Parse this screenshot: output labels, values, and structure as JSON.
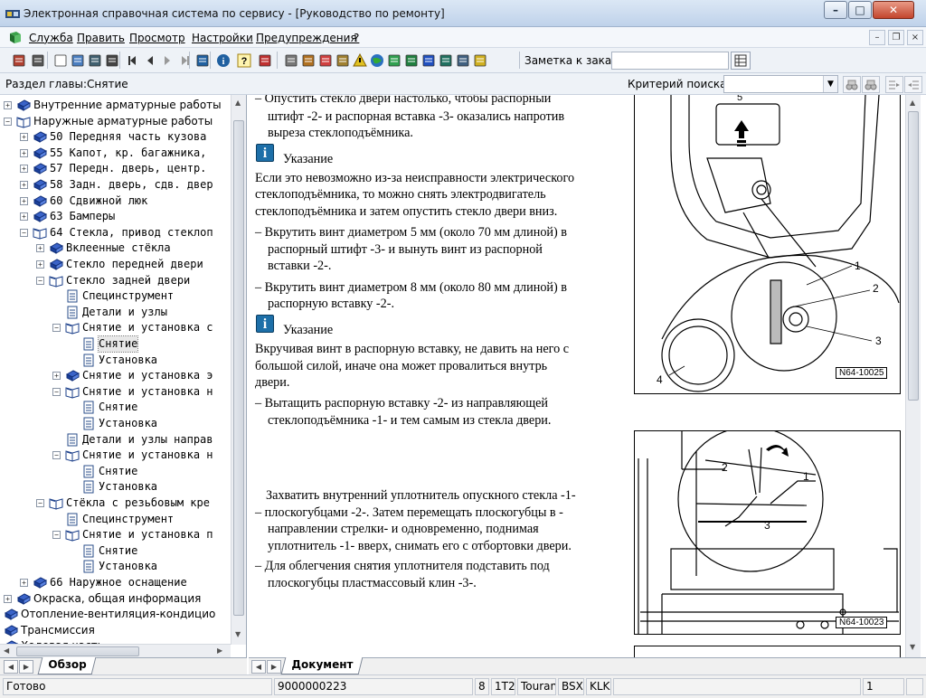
{
  "window": {
    "title": "Электронная справочная система по сервису - [Руководство по ремонту]",
    "controls": {
      "minimize": "–",
      "maximize": "□",
      "close": "✕"
    }
  },
  "menu": {
    "items": [
      "Служба",
      "Править",
      "Просмотр",
      "Настройки",
      "Предупреждения",
      "?"
    ],
    "mdi_controls": {
      "minimize": "–",
      "restore": "❐",
      "close": "×"
    }
  },
  "toolbar": {
    "icons": [
      "print-setup-icon",
      "print-icon",
      "new-document-icon",
      "edit-document-icon",
      "open-book-icon",
      "car-icon",
      "first-page-icon",
      "previous-page-icon",
      "next-page-icon",
      "last-page-icon",
      "tag-icon",
      "info-icon",
      "help-icon",
      "refresh-icon",
      "calculator-icon",
      "grid-icon",
      "ticket-icon",
      "notes-icon",
      "warning-icon",
      "globe-icon",
      "paint-icon",
      "bookmark-icon",
      "car-arrow-icon",
      "wrench-icon",
      "document-pencil-icon",
      "question-book-icon"
    ],
    "note_label": "Заметка к заказу:",
    "note_value": ""
  },
  "searchbar": {
    "section_label": "Раздел главы:Снятие",
    "criteria_label": "Критерий  поиска:",
    "criteria_value": ""
  },
  "tree": [
    {
      "level": 0,
      "toggle": "+",
      "icon": "book",
      "label": "Внутренние арматурные работы",
      "mono": false
    },
    {
      "level": 0,
      "toggle": "-",
      "icon": "book-open",
      "label": "Наружные арматурные работы",
      "mono": false
    },
    {
      "level": 1,
      "toggle": "+",
      "icon": "book",
      "label": "50 Передняя часть кузова",
      "mono": true
    },
    {
      "level": 1,
      "toggle": "+",
      "icon": "book",
      "label": "55 Капот, кр. багажника,",
      "mono": true
    },
    {
      "level": 1,
      "toggle": "+",
      "icon": "book",
      "label": "57 Передн. дверь, центр.",
      "mono": true
    },
    {
      "level": 1,
      "toggle": "+",
      "icon": "book",
      "label": "58 Задн. дверь, сдв. двер",
      "mono": true
    },
    {
      "level": 1,
      "toggle": "+",
      "icon": "book",
      "label": "60 Сдвижной люк",
      "mono": true
    },
    {
      "level": 1,
      "toggle": "+",
      "icon": "book",
      "label": "63 Бамперы",
      "mono": true
    },
    {
      "level": 1,
      "toggle": "-",
      "icon": "book-open",
      "label": "64 Стекла, привод стеклоп",
      "mono": true
    },
    {
      "level": 2,
      "toggle": "+",
      "icon": "book",
      "label": "Вклеенные стёкла",
      "mono": true
    },
    {
      "level": 2,
      "toggle": "+",
      "icon": "book",
      "label": "Стекло передней двери",
      "mono": true
    },
    {
      "level": 2,
      "toggle": "-",
      "icon": "book-open",
      "label": "Стекло задней двери",
      "mono": true
    },
    {
      "level": 3,
      "toggle": "",
      "icon": "page",
      "label": "Специнструмент",
      "mono": true
    },
    {
      "level": 3,
      "toggle": "",
      "icon": "page",
      "label": "Детали и узлы",
      "mono": true
    },
    {
      "level": 3,
      "toggle": "-",
      "icon": "book-open",
      "label": "Снятие и установка с",
      "mono": true
    },
    {
      "level": 4,
      "toggle": "",
      "icon": "page",
      "label": "Снятие",
      "mono": true,
      "selected": true
    },
    {
      "level": 4,
      "toggle": "",
      "icon": "page",
      "label": "Установка",
      "mono": true
    },
    {
      "level": 3,
      "toggle": "+",
      "icon": "book",
      "label": "Снятие и установка э",
      "mono": true
    },
    {
      "level": 3,
      "toggle": "-",
      "icon": "book-open",
      "label": "Снятие и установка н",
      "mono": true
    },
    {
      "level": 4,
      "toggle": "",
      "icon": "page",
      "label": "Снятие",
      "mono": true
    },
    {
      "level": 4,
      "toggle": "",
      "icon": "page",
      "label": "Установка",
      "mono": true
    },
    {
      "level": 3,
      "toggle": "",
      "icon": "page",
      "label": "Детали и узлы направ",
      "mono": true
    },
    {
      "level": 3,
      "toggle": "-",
      "icon": "book-open",
      "label": "Снятие и установка н",
      "mono": true
    },
    {
      "level": 4,
      "toggle": "",
      "icon": "page",
      "label": "Снятие",
      "mono": true
    },
    {
      "level": 4,
      "toggle": "",
      "icon": "page",
      "label": "Установка",
      "mono": true
    },
    {
      "level": 2,
      "toggle": "-",
      "icon": "book-open",
      "label": "Стёкла с резьбовым кре",
      "mono": true
    },
    {
      "level": 3,
      "toggle": "",
      "icon": "page",
      "label": "Специнструмент",
      "mono": true
    },
    {
      "level": 3,
      "toggle": "-",
      "icon": "book-open",
      "label": "Снятие и установка п",
      "mono": true
    },
    {
      "level": 4,
      "toggle": "",
      "icon": "page",
      "label": "Снятие",
      "mono": true
    },
    {
      "level": 4,
      "toggle": "",
      "icon": "page",
      "label": "Установка",
      "mono": true
    },
    {
      "level": 1,
      "toggle": "+",
      "icon": "book",
      "label": "66 Наружное оснащение",
      "mono": true
    },
    {
      "level": 0,
      "toggle": "+",
      "icon": "book",
      "label": "Окраска, общая информация",
      "mono": false
    },
    {
      "level": -1,
      "toggle": "",
      "icon": "book",
      "label": "Отопление-вентиляция-кондицио",
      "mono": false
    },
    {
      "level": -1,
      "toggle": "",
      "icon": "book",
      "label": "Трансмиссия",
      "mono": false
    },
    {
      "level": -1,
      "toggle": "",
      "icon": "book",
      "label": "Ходовая часть",
      "mono": false
    }
  ],
  "tabs": {
    "left": "Обзор",
    "right": "Документ"
  },
  "document": {
    "para1": [
      "– Опустить стекло двери настолько, чтобы распорный",
      "штифт -2- и распорная вставка -3- оказались напротив",
      "выреза стеклоподъёмника."
    ],
    "note1_title": "Указание",
    "note1_text": [
      "Если это невозможно из-за неисправности электрического",
      "стеклоподъёмника, то можно снять электродвигатель",
      "стеклоподъёмника и затем опустить стекло двери вниз."
    ],
    "para2": [
      "– Вкрутить винт диаметром 5 мм (около 70 мм длиной) в",
      "распорный штифт -3- и вынуть винт из распорной",
      "вставки -2-."
    ],
    "para3": [
      "– Вкрутить винт диаметром 8 мм (около 80 мм длиной) в",
      "распорную вставку -2-."
    ],
    "note2_title": "Указание",
    "note2_text": [
      "Вкручивая винт в распорную вставку, не давить на него с",
      "большой силой, иначе она может провалиться внутрь",
      "двери."
    ],
    "para4": [
      "– Вытащить распорную вставку -2- из направляющей",
      "стеклоподъёмника -1- и тем самым из стекла двери."
    ],
    "para5": [
      "Захватить внутренний уплотнитель опускного стекла -1-",
      "– плоскогубцами -2-. Затем перемещать плоскогубцы в -",
      "направлении стрелки- и одновременно, поднимая",
      "уплотнитель -1- вверх, снимать его с отбортовки двери."
    ],
    "para6": [
      "– Для облегчения снятия уплотнителя подставить под",
      "плоскогубцы пластмассовый клин -3-."
    ],
    "figure1": {
      "code": "N64-10025",
      "callouts": [
        "1",
        "2",
        "3",
        "4",
        "5"
      ]
    },
    "figure2": {
      "code": "N64-10023",
      "callouts": [
        "1",
        "2",
        "3"
      ]
    }
  },
  "status": {
    "text": "Готово",
    "order": "9000000223",
    "num": "8",
    "engine": "1T2",
    "model": "Touran",
    "code1": "BSX",
    "code2": "KLK",
    "page": "1"
  }
}
